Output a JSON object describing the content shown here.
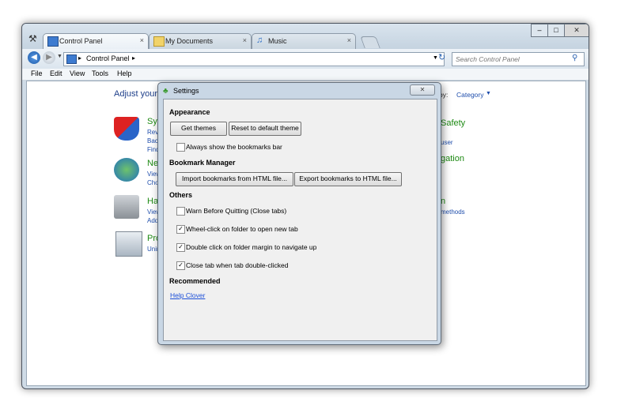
{
  "tabs": [
    {
      "label": "Control Panel",
      "icon": "control-panel-icon",
      "close": "×"
    },
    {
      "label": "My Documents",
      "icon": "folder-icon",
      "close": "×"
    },
    {
      "label": "Music",
      "icon": "music-icon",
      "close": "×"
    }
  ],
  "address": {
    "crumb": "Control Panel"
  },
  "search": {
    "placeholder": "Search Control Panel"
  },
  "menu": [
    "File",
    "Edit",
    "View",
    "Tools",
    "Help"
  ],
  "control_panel": {
    "heading": "Adjust your",
    "view_by": "by:",
    "view_value": "Category",
    "sections": [
      {
        "title": "Sys",
        "links": [
          "Revi",
          "Bac",
          "Find"
        ]
      },
      {
        "title": "Ne",
        "links": [
          "View",
          "Cho"
        ]
      },
      {
        "title": "Ha",
        "links": [
          "View",
          "Add"
        ]
      },
      {
        "title": "Pro",
        "links": [
          "Unin"
        ]
      }
    ],
    "right": [
      {
        "title": "Safety",
        "link": "user"
      },
      {
        "title": "gation",
        "link": ""
      },
      {
        "title": "n",
        "link": "methods"
      }
    ]
  },
  "dialog": {
    "title": "Settings",
    "close": "✕",
    "appearance": {
      "label": "Appearance",
      "get_themes": "Get themes",
      "reset": "Reset to default theme",
      "bookmarks_bar": "Always show the bookmarks bar",
      "bookmarks_bar_checked": false
    },
    "bookmark_manager": {
      "label": "Bookmark Manager",
      "import": "Import bookmarks from HTML file...",
      "export": "Export bookmarks to HTML file..."
    },
    "others": {
      "label": "Others",
      "options": [
        {
          "label": "Warn Before Quitting (Close tabs)",
          "checked": false
        },
        {
          "label": "Wheel-click on folder to open new tab",
          "checked": true
        },
        {
          "label": "Double click on folder margin to navigate up",
          "checked": true
        },
        {
          "label": "Close tab when tab double-clicked",
          "checked": true
        }
      ]
    },
    "recommended": {
      "label": "Recommended",
      "link": "Help Clover"
    }
  }
}
